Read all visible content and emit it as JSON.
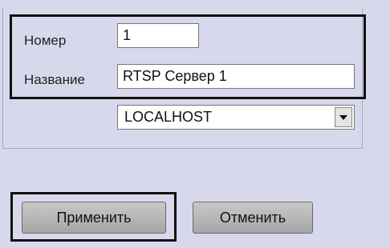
{
  "form": {
    "number_label": "Номер",
    "number_value": "1",
    "name_label": "Название",
    "name_value": "RTSP Сервер 1",
    "host_value": "LOCALHOST"
  },
  "buttons": {
    "apply_label": "Применить",
    "cancel_label": "Отменить"
  },
  "colors": {
    "panel_bg": "#d8d8ec",
    "highlight_frame": "#111111"
  },
  "icons": {
    "dropdown": "chevron-down-icon"
  }
}
